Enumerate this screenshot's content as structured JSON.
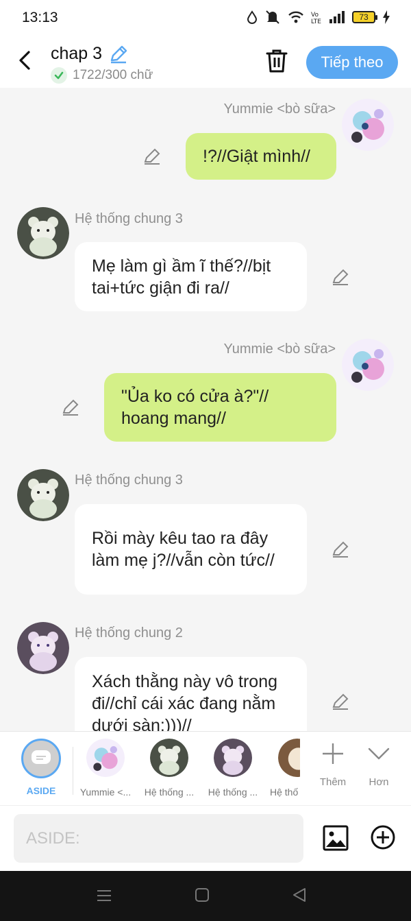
{
  "status_bar": {
    "time": "13:13",
    "battery": "73"
  },
  "header": {
    "title": "chap 3",
    "word_count": "1722/300 chữ",
    "next_label": "Tiếp theo"
  },
  "messages": [
    {
      "sender": "Yummie <bò sữa>",
      "text": "!?//Giật mình//",
      "side": "right",
      "color": "#d4f088"
    },
    {
      "sender": "Hệ thống chung 3",
      "text": "Mẹ làm gì ầm ĩ thế?//bịt tai+tức giận đi ra//",
      "side": "left"
    },
    {
      "sender": "Yummie <bò sữa>",
      "text": "\"Ủa ko có cửa à?\"// hoang mang//",
      "side": "right"
    },
    {
      "sender": "Hệ thống chung 3",
      "text": "Rồi mày kêu tao ra đây làm mẹ j?//vẫn còn tức//",
      "side": "left"
    },
    {
      "sender": "Hệ thống chung 2",
      "text": "Xách thằng này vô trong đi//chỉ cái xác đang nằm dưới sàn:)))//",
      "side": "left"
    }
  ],
  "character_bar": {
    "aside_label": "ASIDE",
    "characters": [
      "Yummie <...",
      "Hệ thống ...",
      "Hệ thống ...",
      "Hệ thố"
    ],
    "add_label": "Thêm",
    "more_label": "Hơn"
  },
  "input": {
    "placeholder": "ASIDE:"
  },
  "colors": {
    "accent": "#5aa8f2",
    "user_bubble": "#d4f088",
    "aside_ring": "#5aa8f2"
  },
  "icons": [
    "back-icon",
    "pencil-icon",
    "check-icon",
    "trash-icon",
    "image-icon",
    "plus-circle-icon",
    "add-icon",
    "chevron-down-icon",
    "menu-icon",
    "home-icon",
    "back-nav-icon"
  ]
}
